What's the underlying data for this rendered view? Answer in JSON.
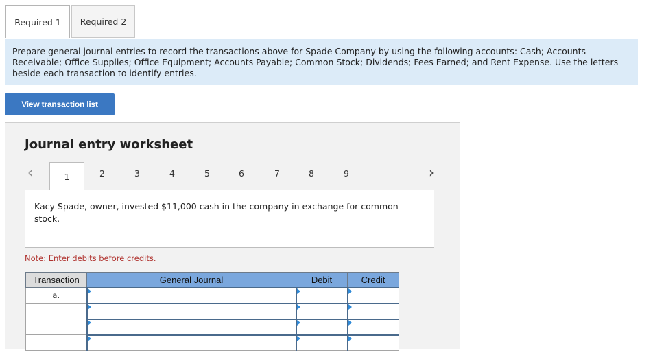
{
  "tabs": [
    {
      "label": "Required 1",
      "active": true
    },
    {
      "label": "Required 2",
      "active": false
    }
  ],
  "instructions": "Prepare general journal entries to record the transactions above for Spade Company by using the following accounts: Cash; Accounts Receivable; Office Supplies; Office Equipment; Accounts Payable; Common Stock; Dividends; Fees Earned; and Rent Expense. Use the letters beside each transaction to identify entries.",
  "view_button_label": "View transaction list",
  "worksheet": {
    "title": "Journal entry worksheet",
    "pages": [
      "1",
      "2",
      "3",
      "4",
      "5",
      "6",
      "7",
      "8",
      "9"
    ],
    "active_page": "1",
    "description": "Kacy Spade, owner, invested $11,000 cash in the company in exchange for common stock.",
    "note": "Note: Enter debits before credits.",
    "table": {
      "headers": [
        "Transaction",
        "General Journal",
        "Debit",
        "Credit"
      ],
      "rows": [
        {
          "transaction": "a.",
          "account": "",
          "debit": "",
          "credit": ""
        },
        {
          "transaction": "",
          "account": "",
          "debit": "",
          "credit": ""
        },
        {
          "transaction": "",
          "account": "",
          "debit": "",
          "credit": ""
        },
        {
          "transaction": "",
          "account": "",
          "debit": "",
          "credit": ""
        }
      ]
    }
  },
  "colors": {
    "accent": "#3b78c2",
    "instruction_bg": "#dcebf8",
    "header_blue": "#7aa7dd",
    "note_red": "#b0322e"
  }
}
